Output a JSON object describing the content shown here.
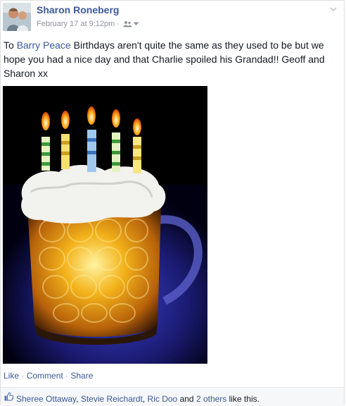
{
  "post": {
    "author": "Sharon Roneberg",
    "timestamp": "February 17 at 9:12pm",
    "separator": "·",
    "audience_icon": "friends-icon",
    "text_prefix": "To ",
    "mention": "Barry Peace",
    "text_body": " Birthdays aren't quite the same as they used to be but we hope you had a nice day and that Charlie spoiled his Grandad!! Geoff and Sharon xx"
  },
  "actions": {
    "like": "Like",
    "comment": "Comment",
    "share": "Share",
    "sep": " · "
  },
  "likes": {
    "names": [
      "Sheree Ottaway",
      "Stevie Reichardt",
      "Ric Doo"
    ],
    "comma": ", ",
    "and": " and ",
    "others": "2 others",
    "suffix": " like this."
  },
  "colors": {
    "link": "#3b5998",
    "meta": "#90949c",
    "bar_bg": "#f6f7f9"
  }
}
